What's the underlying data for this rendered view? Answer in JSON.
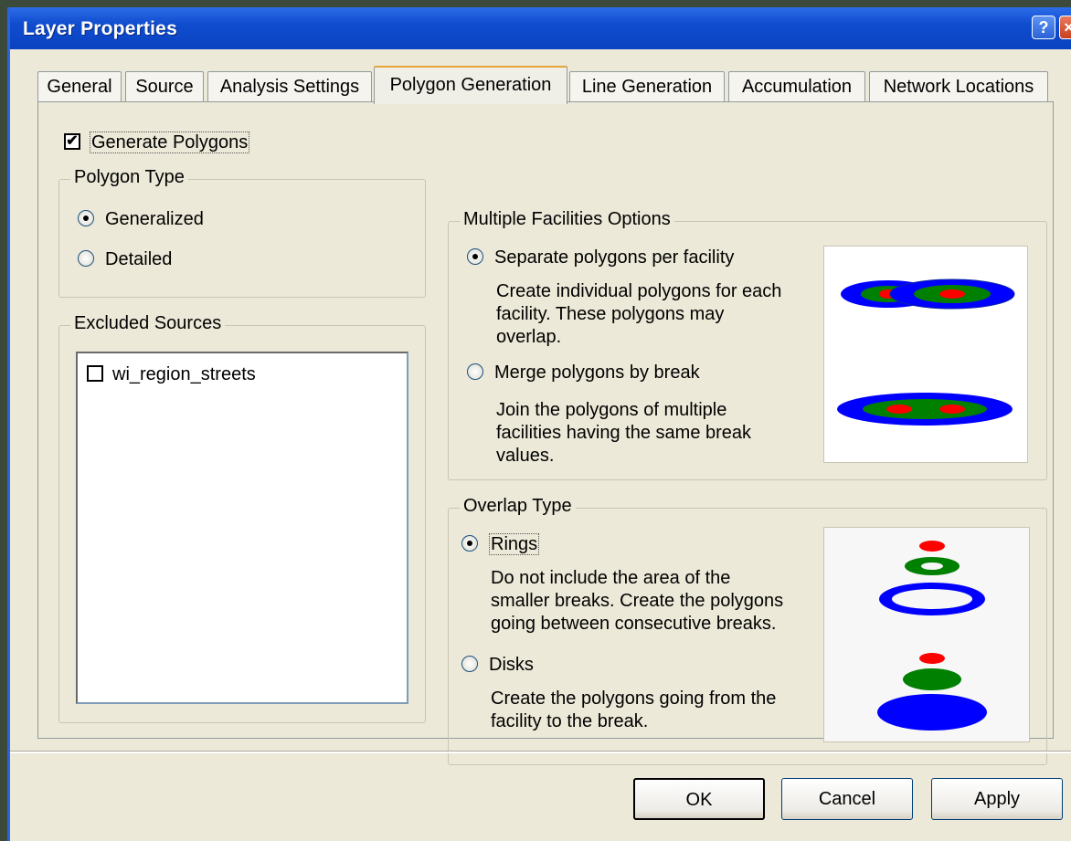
{
  "window": {
    "title": "Layer Properties",
    "help_label": "?",
    "close_label": "×"
  },
  "tabs": [
    {
      "label": "General"
    },
    {
      "label": "Source"
    },
    {
      "label": "Analysis Settings"
    },
    {
      "label": "Polygon Generation"
    },
    {
      "label": "Line Generation"
    },
    {
      "label": "Accumulation"
    },
    {
      "label": "Network Locations"
    }
  ],
  "active_tab": "Polygon Generation",
  "generate_polygons": {
    "label": "Generate Polygons",
    "checked": true
  },
  "polygon_type": {
    "title": "Polygon Type",
    "options": [
      {
        "label": "Generalized",
        "selected": true
      },
      {
        "label": "Detailed",
        "selected": false
      }
    ]
  },
  "excluded_sources": {
    "title": "Excluded Sources",
    "items": [
      {
        "label": "wi_region_streets",
        "checked": false
      }
    ]
  },
  "multiple_facilities": {
    "title": "Multiple Facilities Options",
    "options": [
      {
        "label": "Separate polygons per facility",
        "selected": true,
        "description": [
          "Create individual polygons for each",
          "facility. These polygons may",
          "overlap."
        ]
      },
      {
        "label": "Merge polygons by break",
        "selected": false,
        "description": [
          "Join the polygons of multiple",
          "facilities having the same break",
          "values."
        ]
      }
    ]
  },
  "overlap_type": {
    "title": "Overlap Type",
    "options": [
      {
        "label": "Rings",
        "selected": true,
        "description": [
          "Do not include the area of the",
          "smaller breaks. Create the polygons",
          "going between consecutive breaks."
        ]
      },
      {
        "label": "Disks",
        "selected": false,
        "description": [
          "Create the polygons going from the",
          "facility to the break."
        ]
      }
    ]
  },
  "colors": {
    "outer": "#0000ff",
    "middle": "#008000",
    "inner": "#ff0000"
  },
  "buttons": {
    "ok": "OK",
    "cancel": "Cancel",
    "apply": "Apply"
  }
}
